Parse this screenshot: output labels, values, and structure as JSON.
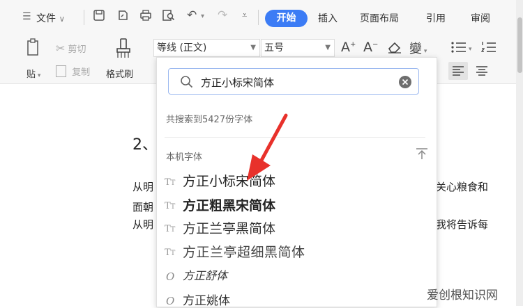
{
  "menubar": {
    "file_label": "文件",
    "tabs": [
      "开始",
      "插入",
      "页面布局",
      "引用",
      "审阅"
    ]
  },
  "ribbon": {
    "cut_label": "剪切",
    "paste_label": "贴",
    "copy_label": "复制",
    "format_painter_label": "格式刷",
    "font_name": "等线 (正文)",
    "font_size": "五号",
    "phonetic_glyph": "變"
  },
  "search": {
    "query": "方正小标宋简体",
    "result_text": "共搜索到5427份字体"
  },
  "font_list": {
    "section_title": "本机字体",
    "pin_glyph": "ㅈ",
    "items": [
      "方正小标宋简体",
      "方正粗黑宋简体",
      "方正兰亭黑简体",
      "方正兰亭超细黑简体",
      "方正舒体",
      "方正姚体"
    ]
  },
  "document": {
    "heading_fragment": "2、",
    "line1_left": "从明",
    "line1_right": "关心粮食和",
    "line2_left": "面朝",
    "line3_left": "从明",
    "line3_right": "我将告诉每"
  },
  "watermark": "爱创根知识网",
  "colors": {
    "accent": "#3c7cf5",
    "arrow": "#e8312b"
  }
}
